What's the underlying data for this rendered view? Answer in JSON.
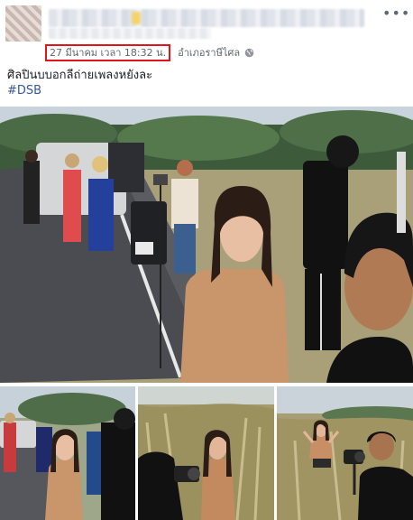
{
  "post": {
    "timestamp": "27 มีนาคม เวลา 18:32 น.",
    "location": "อำเภอราษีไศล",
    "privacy_icon": "globe-icon",
    "more_icon": "more-dots-icon",
    "more_label": "•••",
    "caption": "ศิลปินบบอกลีถ่ายเพลงหยังละ",
    "hashtag": "#DSB",
    "accent_color": "#e0161b",
    "link_color": "#385898"
  },
  "photos": {
    "count": 4
  }
}
